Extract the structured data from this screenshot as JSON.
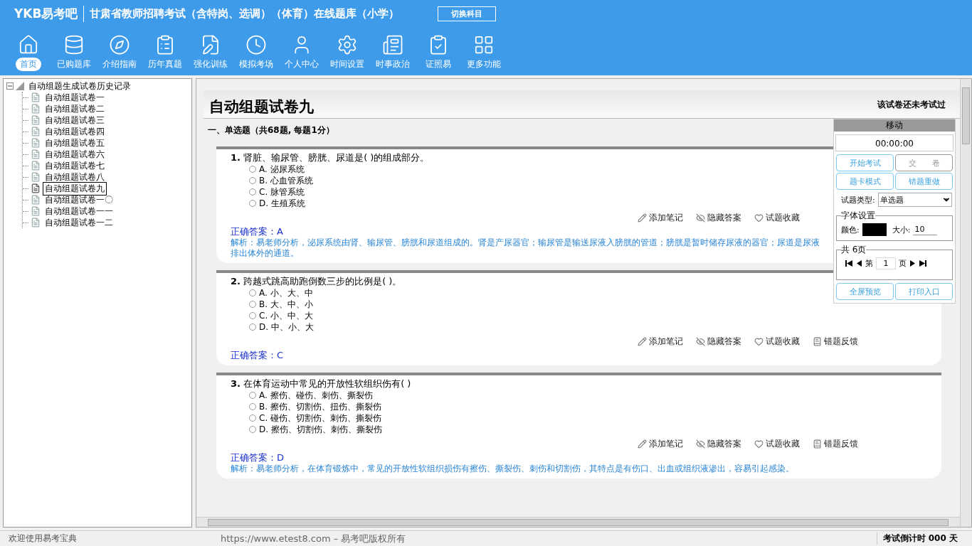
{
  "header": {
    "logo": "YKB易考吧",
    "title": "甘肃省教师招聘考试（含特岗、选调）（体育）在线题库（小学）",
    "switch_button": "切换科目"
  },
  "nav": [
    {
      "label": "首页",
      "selected": true
    },
    {
      "label": "已购题库",
      "selected": false
    },
    {
      "label": "介绍指南",
      "selected": false
    },
    {
      "label": "历年真题",
      "selected": false
    },
    {
      "label": "强化训练",
      "selected": false
    },
    {
      "label": "模拟考场",
      "selected": false
    },
    {
      "label": "个人中心",
      "selected": false
    },
    {
      "label": "时间设置",
      "selected": false
    },
    {
      "label": "时事政治",
      "selected": false
    },
    {
      "label": "证照易",
      "selected": false
    },
    {
      "label": "更多功能",
      "selected": false
    }
  ],
  "tree": {
    "label": "自动组题生成试卷历史记录",
    "expanded": true,
    "children": [
      {
        "label": "自动组题试卷一",
        "selected": false
      },
      {
        "label": "自动组题试卷二",
        "selected": false
      },
      {
        "label": "自动组题试卷三",
        "selected": false
      },
      {
        "label": "自动组题试卷四",
        "selected": false
      },
      {
        "label": "自动组题试卷五",
        "selected": false
      },
      {
        "label": "自动组题试卷六",
        "selected": false
      },
      {
        "label": "自动组题试卷七",
        "selected": false
      },
      {
        "label": "自动组题试卷八",
        "selected": false
      },
      {
        "label": "自动组题试卷九",
        "selected": true
      },
      {
        "label": "自动组题试卷一〇",
        "selected": false
      },
      {
        "label": "自动组题试卷一一",
        "selected": false
      },
      {
        "label": "自动组题试卷一二",
        "selected": false
      }
    ]
  },
  "paper": {
    "title": "自动组题试卷九",
    "status": "该试卷还未考试过",
    "section": "一、单选题（共68题, 每题1分）",
    "questions": [
      {
        "number": "1.",
        "text": "肾脏、输尿管、膀胱、尿道是( )的组成部分。",
        "options": [
          {
            "letter": "A.",
            "text": "泌尿系统",
            "selected": false
          },
          {
            "letter": "B.",
            "text": "心血管系统",
            "selected": false
          },
          {
            "letter": "C.",
            "text": "脉管系统",
            "selected": false
          },
          {
            "letter": "D.",
            "text": "生殖系统",
            "selected": false
          }
        ],
        "actions": [
          "添加笔记",
          "隐藏答案",
          "试题收藏"
        ],
        "answer": "正确答案：A",
        "analysis": "解析：易老师分析，泌尿系统由肾、输尿管、膀胱和尿道组成的。肾是产尿器官；输尿管是输送尿液入膀胱的管道；膀胱是暂时储存尿液的器官；尿道是尿液排出体外的通道。"
      },
      {
        "number": "2.",
        "text": "跨越式跳高助跑倒数三步的比例是( )。",
        "options": [
          {
            "letter": "A.",
            "text": "小、大、中",
            "selected": false
          },
          {
            "letter": "B.",
            "text": "大、中、小",
            "selected": false
          },
          {
            "letter": "C.",
            "text": "小、中、大",
            "selected": false
          },
          {
            "letter": "D.",
            "text": "中、小、大",
            "selected": false
          }
        ],
        "actions": [
          "添加笔记",
          "隐藏答案",
          "试题收藏",
          "错题反馈"
        ],
        "answer": "正确答案：C"
      },
      {
        "number": "3.",
        "text": "在体育运动中常见的开放性软组织伤有( )",
        "options": [
          {
            "letter": "A.",
            "text": "擦伤、碰伤、刺伤、撕裂伤",
            "selected": false
          },
          {
            "letter": "B.",
            "text": "擦伤、切割伤、扭伤、撕裂伤",
            "selected": false
          },
          {
            "letter": "C.",
            "text": "碰伤、切割伤、刺伤、撕裂伤",
            "selected": false
          },
          {
            "letter": "D.",
            "text": "擦伤、切割伤、刺伤、撕裂伤",
            "selected": false
          }
        ],
        "actions": [
          "添加笔记",
          "隐藏答案",
          "试题收藏",
          "错题反馈"
        ],
        "answer": "正确答案：D",
        "analysis": "解析：易老师分析，在体育锻炼中，常见的开放性软组织损伤有擦伤、撕裂伤、刺伤和切割伤，其特点是有伤口、出血或组织液渗出，容易引起感染。"
      }
    ]
  },
  "panel": {
    "handle": "移动",
    "timer": "00:00:00",
    "buttons": [
      {
        "label": "开始考试",
        "disabled": false
      },
      {
        "label": "交　　卷",
        "disabled": true
      },
      {
        "label": "题卡模式",
        "disabled": false
      },
      {
        "label": "错题重做",
        "disabled": false
      }
    ],
    "question_type": {
      "label": "试题类型:",
      "value": "单选题"
    },
    "font": {
      "legend": "字体设置",
      "color_label": "颜色:",
      "color": "#000000",
      "size_label": "大小:",
      "size": "10"
    },
    "pager": {
      "legend": "共 6页",
      "prefix": "第",
      "page": "1",
      "suffix": "页"
    },
    "bottom_buttons": [
      {
        "label": "全屏预览",
        "disabled": false
      },
      {
        "label": "打印入口",
        "disabled": false
      }
    ]
  },
  "status_bar": {
    "welcome": "欢迎使用易考宝典",
    "copyright": "https://www.etest8.com – 易考吧版权所有",
    "countdown": "考试倒计时 000 天"
  }
}
